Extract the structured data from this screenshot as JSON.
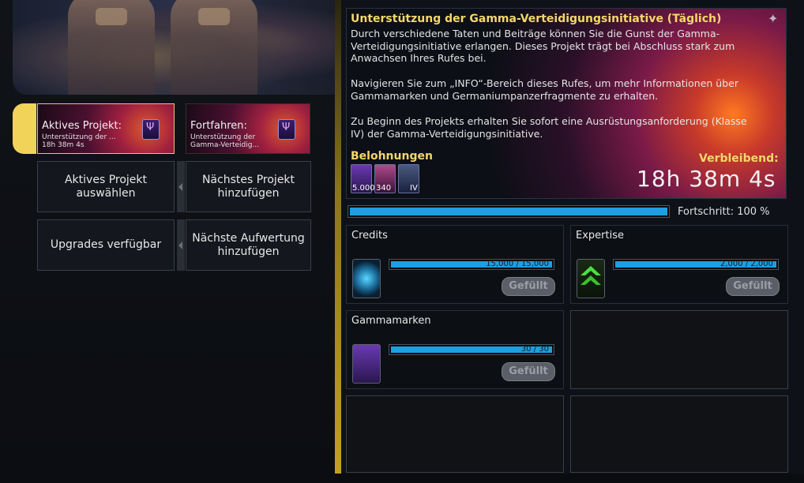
{
  "left": {
    "active_card": {
      "title": "Aktives Projekt:",
      "subtitle": "Unterstützung der ...",
      "timer": "18h 38m 4s"
    },
    "next_card": {
      "title": "Fortfahren:",
      "subtitle_line1": "Unterstützung der",
      "subtitle_line2": "Gamma-Verteidig..."
    },
    "buttons": {
      "select_active_line1": "Aktives Projekt",
      "select_active_line2": "auswählen",
      "add_next_line1": "Nächstes Projekt",
      "add_next_line2": "hinzufügen",
      "upgrades": "Upgrades verfügbar",
      "add_upgrade_line1": "Nächste Aufwertung",
      "add_upgrade_line2": "hinzufügen"
    }
  },
  "project": {
    "title": "Unterstützung der Gamma-Verteidigungsinitiative (Täglich)",
    "description_p1": "Durch verschiedene Taten und Beiträge können Sie die Gunst der Gamma-Verteidigungsinitiative erlangen. Dieses Projekt trägt bei Abschluss stark zum Anwachsen Ihres Rufes bei.",
    "description_p2": "Navigieren Sie zum „INFO“-Bereich dieses Rufes, um mehr Informationen über Gammamarken und Germaniumpanzerfragmente zu erhalten.",
    "description_p3": "Zu Beginn des Projekts erhalten Sie sofort eine Ausrüstungsanforderung (Klasse IV) der Gamma-Verteidigungsinitiative.",
    "rewards_label": "Belohnungen",
    "rewards": [
      {
        "icon": "gamma-mark-icon",
        "qty": "5.000"
      },
      {
        "icon": "armor-fragment-icon",
        "qty": "340"
      },
      {
        "icon": "requisition-icon",
        "qty": "IV"
      }
    ],
    "remaining_label": "Verbleibend:",
    "remaining_time": "18h 38m 4s"
  },
  "progress": {
    "label": "Fortschritt: 100 %",
    "fraction": 1.0
  },
  "resources": [
    {
      "label": "Credits",
      "amount": "15,000 / 15,000",
      "fraction": 1.0,
      "button": "Gefüllt",
      "icon": "credits-icon"
    },
    {
      "label": "Expertise",
      "amount": "2,000 / 2,000",
      "fraction": 1.0,
      "button": "Gefüllt",
      "icon": "expertise-icon"
    },
    {
      "label": "Gammamarken",
      "amount": "30 / 30",
      "fraction": 1.0,
      "button": "Gefüllt",
      "icon": "gamma-mark-icon"
    }
  ],
  "colors": {
    "accent_gold": "#f4d76a",
    "progress_blue": "#1d9fe0",
    "tab_yellow": "#f2d35a"
  }
}
